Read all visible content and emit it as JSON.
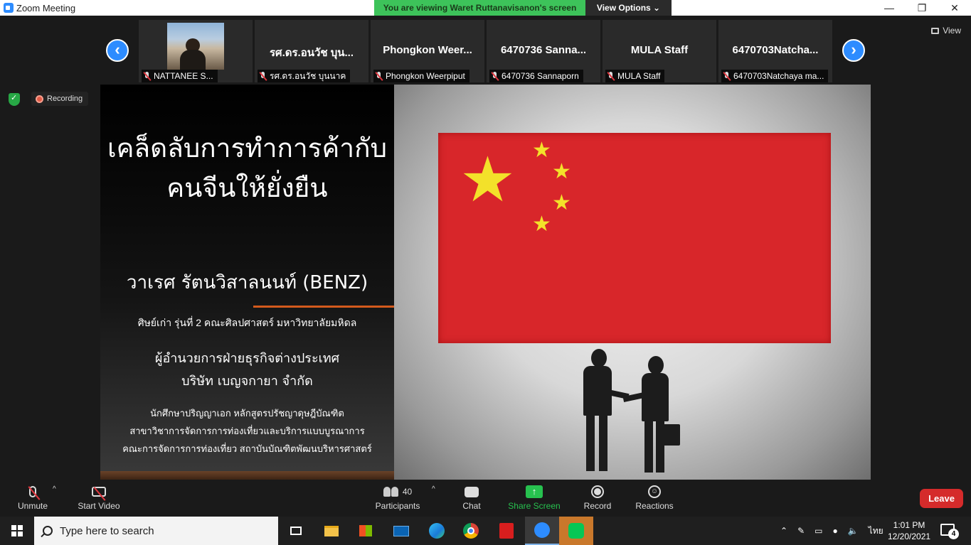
{
  "window": {
    "title": "Zoom Meeting",
    "minimize": "—",
    "maximize": "❐",
    "close": "✕"
  },
  "banner": {
    "message": "You are viewing Waret Ruttanavisanon's screen",
    "view_options": "View Options ⌄"
  },
  "view_button": "View",
  "nav": {
    "prev": "‹",
    "next": "›"
  },
  "participants_strip": [
    {
      "big_name": "",
      "label": "NATTANEE S...",
      "has_video": true
    },
    {
      "big_name": "รศ.ดร.อนวัช บุน...",
      "label": "รศ.ดร.อนวัช บุนนาค"
    },
    {
      "big_name": "Phongkon  Weer...",
      "label": "Phongkon Weerpiput"
    },
    {
      "big_name": "6470736 Sanna...",
      "label": "6470736 Sannaporn"
    },
    {
      "big_name": "MULA Staff",
      "label": "MULA Staff"
    },
    {
      "big_name": "6470703Natcha...",
      "label": "6470703Natchaya ma..."
    }
  ],
  "recording_label": "Recording",
  "slide": {
    "title_line1": "เคล็ดลับการทำการค้ากับ",
    "title_line2": "คนจีนให้ยั่งยืน",
    "presenter": "วาเรศ รัตนวิสาลนนท์ (BENZ)",
    "alumni": "ศิษย์เก่า รุ่นที่ 2 คณะศิลปศาสตร์ มหาวิทยาลัยมหิดล",
    "position_line1": "ผู้อำนวยการฝ่ายธุรกิจต่างประเทศ",
    "position_line2": "บริษัท เบญจกายา จำกัด",
    "study_line1": "นักศึกษาปริญญาเอก หลักสูตรปรัชญาดุษฎีบัณฑิต",
    "study_line2": "สาขาวิชาการจัดการการท่องเที่ยวและบริการแบบบูรณาการ",
    "study_line3": "คณะการจัดการการท่องเที่ยว สถาบันบัณฑิตพัฒนบริหารศาสตร์"
  },
  "toolbar": {
    "unmute": "Unmute",
    "start_video": "Start Video",
    "participants_count": "40",
    "participants": "Participants",
    "chat": "Chat",
    "share_screen": "Share Screen",
    "record": "Record",
    "reactions": "Reactions",
    "leave": "Leave",
    "caret": "^"
  },
  "taskbar": {
    "search_placeholder": "Type here to search",
    "ime": "ไทย",
    "time": "1:01 PM",
    "date": "12/20/2021",
    "notifications": "4"
  },
  "colors": {
    "zoom_blue": "#2d8cff",
    "banner_green": "#3dc35a",
    "leave_red": "#d52b2b",
    "share_green": "#27c14f",
    "flag_red": "#d8262a",
    "flag_star": "#f3e12a",
    "accent_orange": "#d35a1c"
  },
  "icons": [
    "zoom-app-icon",
    "grid-icon",
    "arrow-left-icon",
    "arrow-right-icon",
    "mic-muted-icon",
    "shield-check-icon",
    "record-dot-icon",
    "microphone-icon",
    "video-off-icon",
    "participants-icon",
    "chat-icon",
    "share-screen-icon",
    "record-icon",
    "reactions-icon",
    "windows-icon",
    "search-icon",
    "task-view-icon",
    "file-explorer-icon",
    "store-icon",
    "mail-icon",
    "edge-icon",
    "chrome-icon",
    "acrobat-icon",
    "zoom-icon",
    "line-icon",
    "chevron-up-icon",
    "pen-icon",
    "network-icon",
    "mic-tray-icon",
    "volume-icon",
    "notification-icon"
  ]
}
